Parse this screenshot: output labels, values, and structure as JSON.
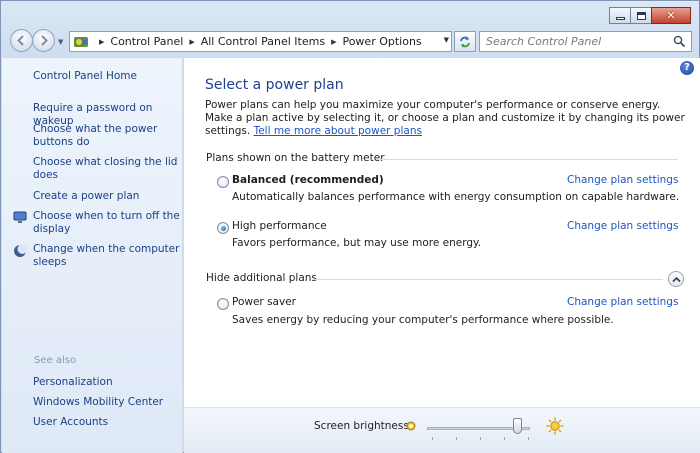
{
  "window": {
    "caption_buttons": [
      "minimize-icon",
      "maximize-icon",
      "close-icon"
    ]
  },
  "address_bar": {
    "icon": "control-panel-icon",
    "breadcrumbs": [
      "Control Panel",
      "All Control Panel Items",
      "Power Options"
    ]
  },
  "search": {
    "placeholder": "Search Control Panel",
    "icon": "search-icon"
  },
  "left_pane": {
    "home": "Control Panel Home",
    "tasks": [
      {
        "label": "Require a password on wakeup",
        "icon": ""
      },
      {
        "label": "Choose what the power buttons do",
        "icon": ""
      },
      {
        "label": "Choose what closing the lid does",
        "icon": ""
      },
      {
        "label": "Create a power plan",
        "icon": ""
      },
      {
        "label": "Choose when to turn off the display",
        "icon": "monitor-icon"
      },
      {
        "label": "Change when the computer sleeps",
        "icon": "moon-icon"
      }
    ],
    "see_also_label": "See also",
    "see_also": [
      "Personalization",
      "Windows Mobility Center",
      "User Accounts"
    ]
  },
  "main": {
    "help_label": "?",
    "title": "Select a power plan",
    "intro": "Power plans can help you maximize your computer's performance or conserve energy. Make a plan active by selecting it, or choose a plan and customize it by changing its power settings. ",
    "intro_link": "Tell me more about power plans",
    "battery_meter_label": "Plans shown on the battery meter",
    "additional_label": "Hide additional plans",
    "change_label": "Change plan settings",
    "plans": [
      {
        "name": "Balanced (recommended)",
        "desc": "Automatically balances performance with energy consumption on capable hardware.",
        "selected": false,
        "bold": true
      },
      {
        "name": "High performance",
        "desc": "Favors performance, but may use more energy.",
        "selected": true,
        "bold": false
      },
      {
        "name": "Power saver",
        "desc": "Saves energy by reducing your computer's performance where possible.",
        "selected": false,
        "bold": false
      }
    ]
  },
  "brightness": {
    "label": "Screen brightness:",
    "level_percent": 88
  },
  "colors": {
    "link": "#1c55c4",
    "nav_link": "#1c3f85",
    "title": "#1f3f90",
    "accent": "#2a5fc4"
  }
}
